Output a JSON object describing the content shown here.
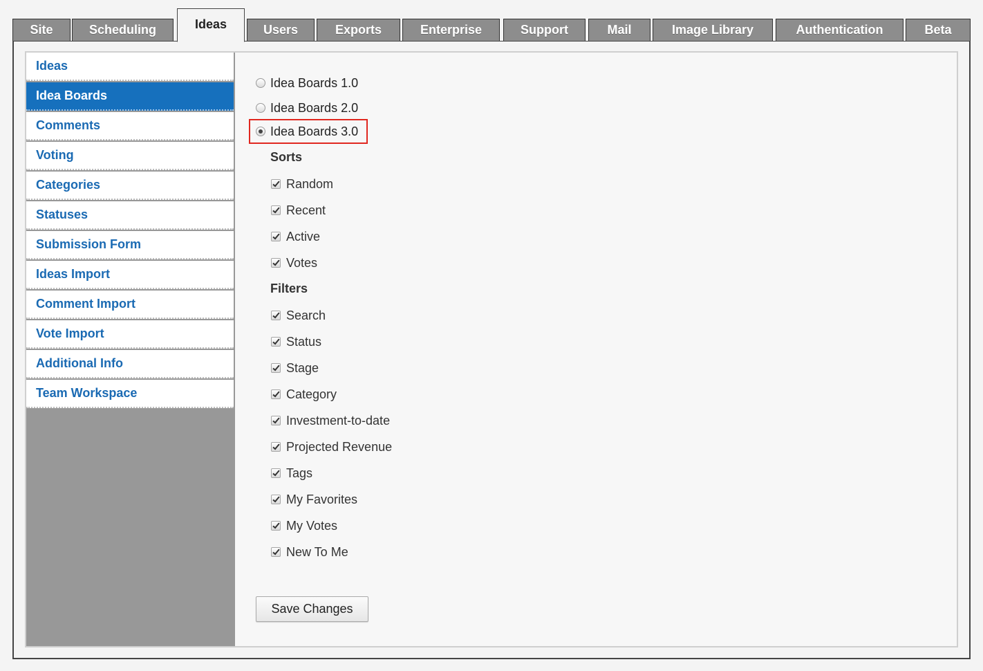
{
  "tabs": [
    {
      "label": "Site",
      "active": false
    },
    {
      "label": "Scheduling",
      "active": false
    },
    {
      "label": "Ideas",
      "active": true
    },
    {
      "label": "Users",
      "active": false
    },
    {
      "label": "Exports",
      "active": false
    },
    {
      "label": "Enterprise",
      "active": false
    },
    {
      "label": "Support",
      "active": false
    },
    {
      "label": "Mail",
      "active": false
    },
    {
      "label": "Image Library",
      "active": false
    },
    {
      "label": "Authentication",
      "active": false
    },
    {
      "label": "Beta",
      "active": false
    }
  ],
  "sidebar": {
    "items": [
      {
        "label": "Ideas",
        "selected": false
      },
      {
        "label": "Idea Boards",
        "selected": true
      },
      {
        "label": "Comments",
        "selected": false
      },
      {
        "label": "Voting",
        "selected": false
      },
      {
        "label": "Categories",
        "selected": false
      },
      {
        "label": "Statuses",
        "selected": false
      },
      {
        "label": "Submission Form",
        "selected": false
      },
      {
        "label": "Ideas Import",
        "selected": false
      },
      {
        "label": "Comment Import",
        "selected": false
      },
      {
        "label": "Vote Import",
        "selected": false
      },
      {
        "label": "Additional Info",
        "selected": false
      },
      {
        "label": "Team Workspace",
        "selected": false
      }
    ]
  },
  "versions": [
    {
      "label": "Idea Boards 1.0",
      "selected": false
    },
    {
      "label": "Idea Boards 2.0",
      "selected": false
    },
    {
      "label": "Idea Boards 3.0",
      "selected": true
    }
  ],
  "sorts": {
    "heading": "Sorts",
    "options": [
      {
        "label": "Random",
        "checked": true
      },
      {
        "label": "Recent",
        "checked": true
      },
      {
        "label": "Active",
        "checked": true
      },
      {
        "label": "Votes",
        "checked": true
      }
    ]
  },
  "filters": {
    "heading": "Filters",
    "options": [
      {
        "label": "Search",
        "checked": true
      },
      {
        "label": "Status",
        "checked": true
      },
      {
        "label": "Stage",
        "checked": true
      },
      {
        "label": "Category",
        "checked": true
      },
      {
        "label": "Investment-to-date",
        "checked": true
      },
      {
        "label": "Projected Revenue",
        "checked": true
      },
      {
        "label": "Tags",
        "checked": true
      },
      {
        "label": "My Favorites",
        "checked": true
      },
      {
        "label": "My Votes",
        "checked": true
      },
      {
        "label": "New To Me",
        "checked": true
      }
    ]
  },
  "save_label": "Save Changes",
  "colors": {
    "accent": "#1670bd",
    "link": "#1a6ab3",
    "highlight": "#e0271f"
  }
}
